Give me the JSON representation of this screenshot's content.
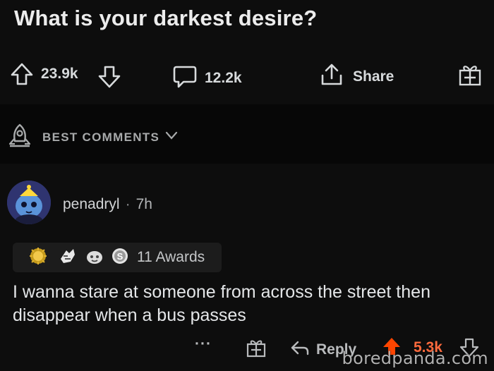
{
  "post": {
    "title": "What is your darkest desire?"
  },
  "action_bar": {
    "upvotes": "23.9k",
    "comments": "12.2k",
    "share_label": "Share"
  },
  "sort": {
    "label": "BEST COMMENTS"
  },
  "comment": {
    "username": "penadryl",
    "separator": "·",
    "time": "7h",
    "awards_label": "11 Awards",
    "body": "I wanna stare at someone from across the street then disappear when a bus passes",
    "more": "···",
    "reply_label": "Reply",
    "score": "5.3k"
  },
  "watermark": "boredpanda.com",
  "colors": {
    "background": "#0d0d0d",
    "upvoted": "#ff4500",
    "score_text": "#ff6a3d"
  }
}
